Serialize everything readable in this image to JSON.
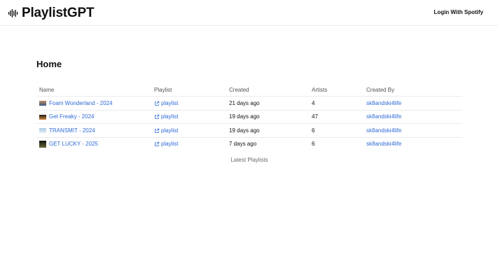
{
  "header": {
    "brand": "PlaylistGPT",
    "brand_icon": "waveform-icon",
    "login_label": "Login With Spotify"
  },
  "main": {
    "title": "Home",
    "table": {
      "columns": [
        "Name",
        "Playlist",
        "Created",
        "Artists",
        "Created By"
      ],
      "rows": [
        {
          "name": "Foam Wonderland - 2024",
          "playlist": "playlist",
          "created": "21 days ago",
          "artists": "4",
          "created_by": "sk8andski4life",
          "thumb_colors": [
            "#c08a5a",
            "#3a5a8c"
          ]
        },
        {
          "name": "Get Freaky - 2024",
          "playlist": "playlist",
          "created": "19 days ago",
          "artists": "47",
          "created_by": "sk8andski4life",
          "thumb_colors": [
            "#1a1a1a",
            "#d4883a"
          ]
        },
        {
          "name": "TRANSMIT - 2024",
          "playlist": "playlist",
          "created": "19 days ago",
          "artists": "6",
          "created_by": "sk8andski4life",
          "thumb_colors": [
            "#a8c8e0",
            "#e8eef4"
          ]
        },
        {
          "name": "GET LUCKY - 2025",
          "playlist": "playlist",
          "created": "7 days ago",
          "artists": "6",
          "created_by": "sk8andski4life",
          "thumb_colors": [
            "#101010",
            "#6a6a3a"
          ]
        }
      ]
    },
    "caption": "Latest Playlists"
  },
  "colors": {
    "link": "#2f6bd6",
    "border": "#ececec"
  }
}
